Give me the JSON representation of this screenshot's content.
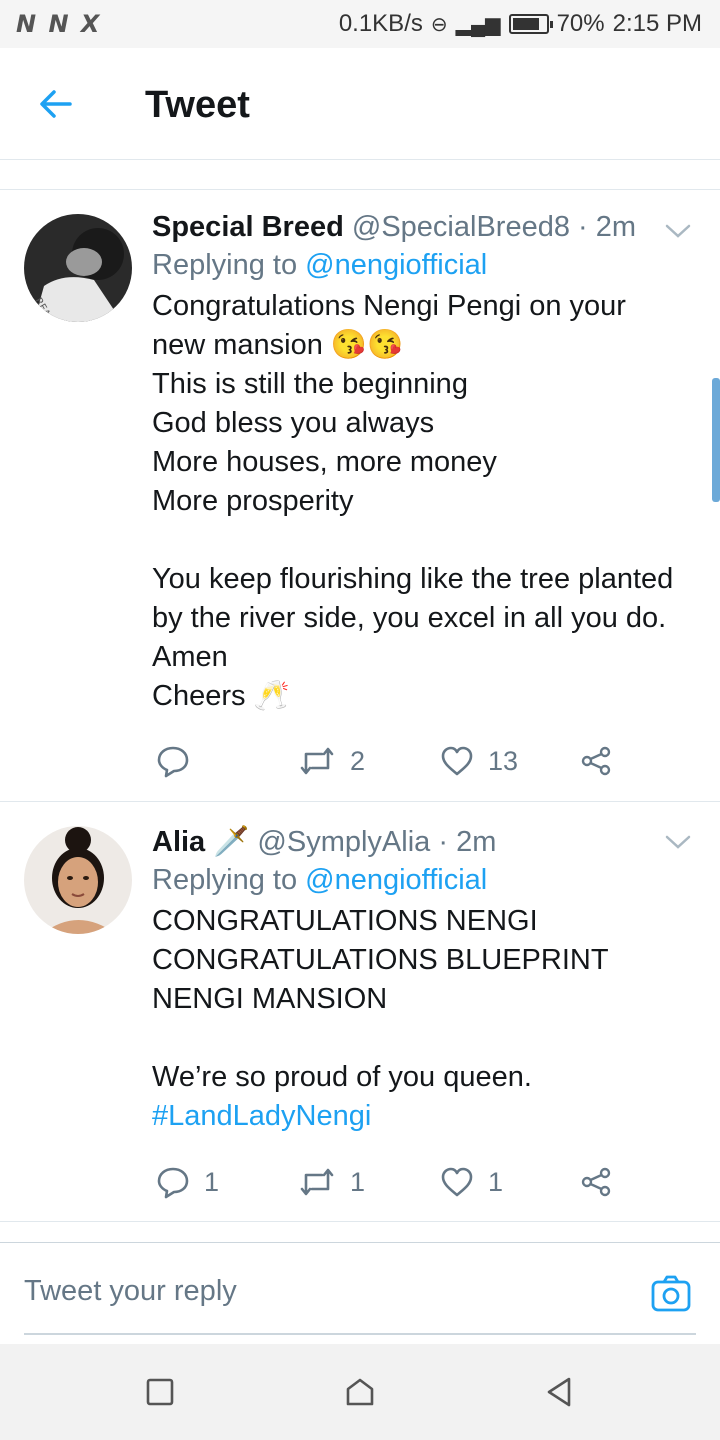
{
  "status_bar": {
    "left_icons": "N N X",
    "network_speed": "0.1KB/s",
    "battery": "70%",
    "time": "2:15 PM"
  },
  "header": {
    "title": "Tweet",
    "back_icon": "arrow-left-icon"
  },
  "tweets": [
    {
      "name": "Special Breed",
      "handle": "@SpecialBreed8",
      "time": "2m",
      "replying_prefix": "Replying to ",
      "replying_to": "@nengiofficial",
      "lines": [
        "Congratulations Nengi Pengi on your",
        "new mansion 😘😘",
        "This is still the beginning",
        "God bless you always",
        "More houses, more money",
        "More prosperity",
        "",
        "You keep flourishing like the tree planted",
        "by the river side, you excel in all you do.",
        "Amen",
        "Cheers 🥂"
      ],
      "replies": "",
      "retweets": "2",
      "likes": "13"
    },
    {
      "name": "Alia",
      "name_emoji": "🗡️",
      "handle": "@SymplyAlia",
      "time": "2m",
      "replying_prefix": "Replying to ",
      "replying_to": "@nengiofficial",
      "lines": [
        "CONGRATULATIONS NENGI",
        "CONGRATULATIONS BLUEPRINT",
        "NENGI MANSION",
        "",
        "We’re so proud of you queen."
      ],
      "hashtag": "#LandLadyNengi",
      "replies": "1",
      "retweets": "1",
      "likes": "1"
    }
  ],
  "reply_bar": {
    "placeholder": "Tweet your reply"
  },
  "colors": {
    "accent": "#1da1f2",
    "secondary_text": "#657786",
    "primary_text": "#14171a",
    "divider": "#e1e8ed"
  }
}
